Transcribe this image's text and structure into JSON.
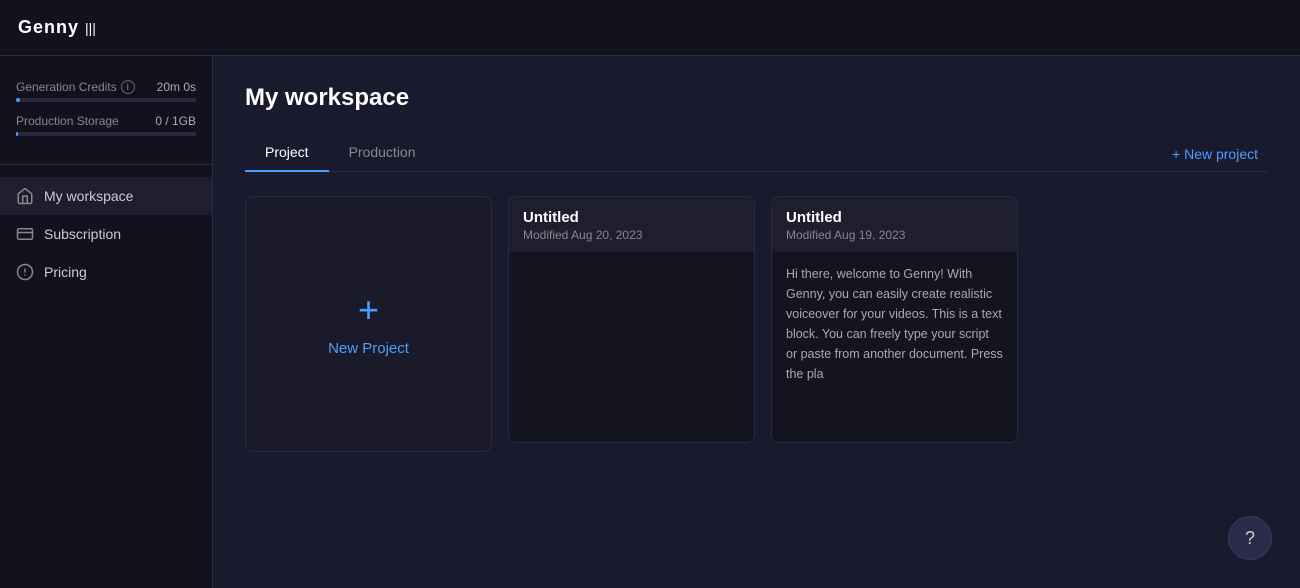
{
  "topbar": {
    "logo_text": "Genny",
    "logo_icon": "|||"
  },
  "sidebar": {
    "credits": {
      "label": "Generation Credits",
      "value": "20m 0s",
      "progress_percent": 2,
      "storage_label": "Production Storage",
      "storage_value": "0 / 1GB",
      "storage_percent": 1
    },
    "nav_items": [
      {
        "id": "my-workspace",
        "label": "My workspace",
        "icon": "home",
        "active": true
      },
      {
        "id": "subscription",
        "label": "Subscription",
        "icon": "subscription",
        "active": false
      },
      {
        "id": "pricing",
        "label": "Pricing",
        "icon": "pricing",
        "active": false
      }
    ]
  },
  "main": {
    "page_title": "My workspace",
    "tabs": [
      {
        "id": "project",
        "label": "Project",
        "active": true
      },
      {
        "id": "production",
        "label": "Production",
        "active": false
      }
    ],
    "new_project_button": "+ New project",
    "new_project_card_label": "New Project",
    "cards": [
      {
        "id": "card-1",
        "title": "Untitled",
        "modified": "Modified Aug 20, 2023",
        "preview": ""
      },
      {
        "id": "card-2",
        "title": "Untitled",
        "modified": "Modified Aug 19, 2023",
        "preview": "Hi there, welcome to Genny! With Genny, you can easily create realistic voiceover for your videos. This is a text block. You can freely type your script or paste from another document. Press the pla"
      }
    ]
  },
  "help_button": "?"
}
